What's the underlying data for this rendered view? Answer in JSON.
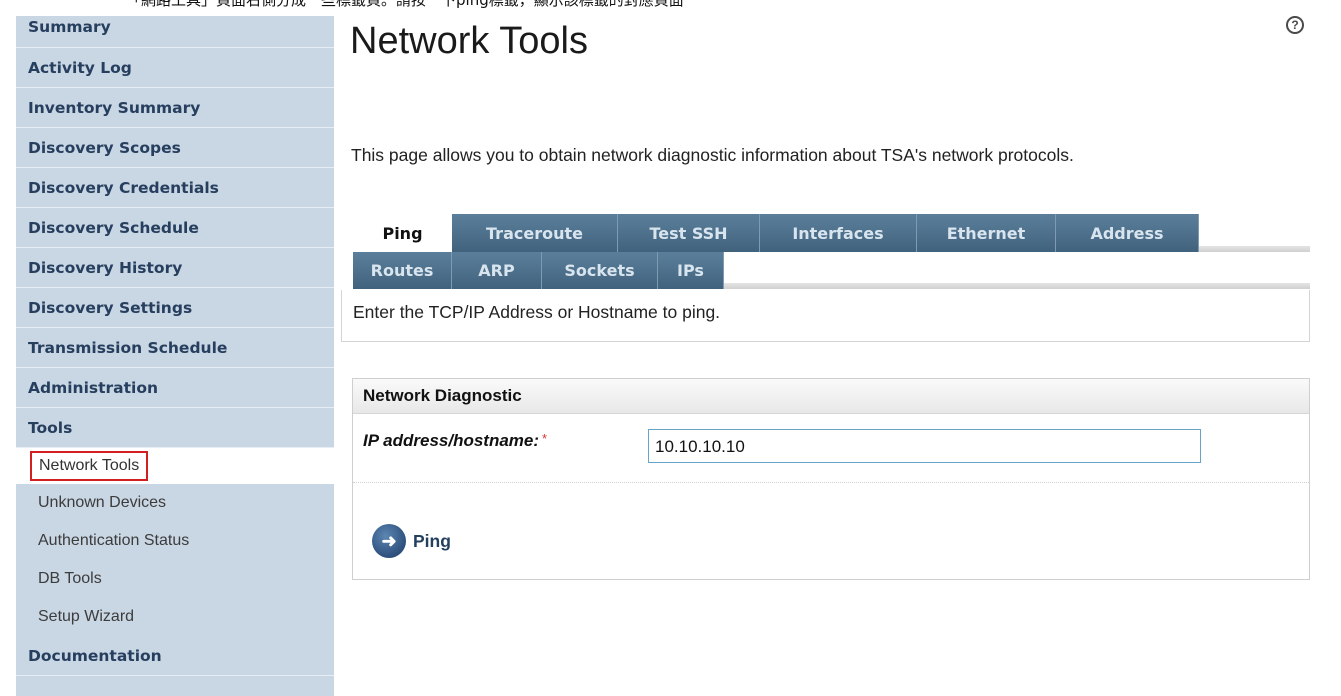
{
  "top_caption": "「網路工具」頁面右側分成一些標籤頁。請按一下ping標籤，顯示該標籤的對應頁面",
  "sidebar": {
    "items": [
      {
        "label": "Summary"
      },
      {
        "label": "Activity Log"
      },
      {
        "label": "Inventory Summary"
      },
      {
        "label": "Discovery Scopes"
      },
      {
        "label": "Discovery Credentials"
      },
      {
        "label": "Discovery Schedule"
      },
      {
        "label": "Discovery History"
      },
      {
        "label": "Discovery Settings"
      },
      {
        "label": "Transmission Schedule"
      },
      {
        "label": "Administration"
      },
      {
        "label": "Tools"
      }
    ],
    "tools_sub": [
      {
        "label": "Network Tools",
        "selected": true
      },
      {
        "label": "Unknown Devices"
      },
      {
        "label": "Authentication Status"
      },
      {
        "label": "DB Tools"
      },
      {
        "label": "Setup Wizard"
      }
    ],
    "after": [
      {
        "label": "Documentation"
      }
    ]
  },
  "help_icon": "?",
  "page": {
    "title": "Network Tools",
    "intro": "This page allows you to obtain network diagnostic information about TSA's network protocols."
  },
  "tabs": {
    "row1": [
      "Ping",
      "Traceroute",
      "Test SSH",
      "Interfaces",
      "Ethernet",
      "Address"
    ],
    "row2": [
      "Routes",
      "ARP",
      "Sockets",
      "IPs"
    ],
    "active": "Ping",
    "panel_text": "Enter the TCP/IP Address or Hostname to ping."
  },
  "diagnostic": {
    "header": "Network Diagnostic",
    "field_label": "IP address/hostname:",
    "required_mark": "*",
    "field_value": "10.10.10.10",
    "button_label": "Ping",
    "button_icon": "arrow-right"
  },
  "colors": {
    "sidebar_bg": "#c9d6e3",
    "nav_text": "#263f5e",
    "tab_bg": "#4d7190",
    "selected_outline": "#d21f1f",
    "input_border": "#6aa3c8"
  }
}
